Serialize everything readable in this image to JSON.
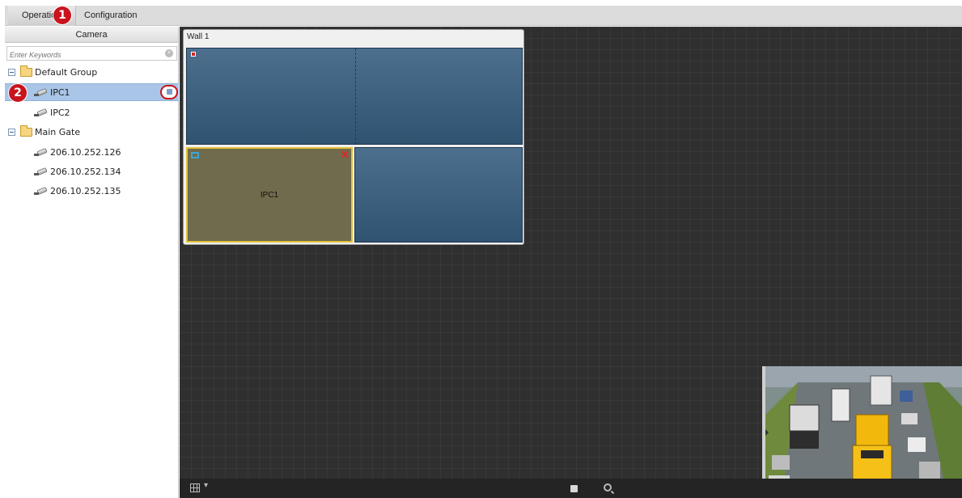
{
  "tabs": {
    "operation": "Operatio",
    "configuration": "Configuration"
  },
  "callouts": {
    "one": "1",
    "two": "2"
  },
  "sidebar": {
    "title": "Camera",
    "search_placeholder": "Enter Keywords",
    "groups": [
      {
        "label": "Default Group",
        "devices": [
          "IPC1",
          "IPC2"
        ]
      },
      {
        "label": "Main Gate",
        "devices": [
          "206.10.252.126",
          "206.10.252.134",
          "206.10.252.135"
        ]
      }
    ]
  },
  "wall": {
    "title": "Wall 1",
    "bound_screen_label": "IPC1"
  },
  "colors": {
    "accent": "#c8141e",
    "selected_row": "#a9c6e8",
    "screen_fill": "#3d6080",
    "bound_screen_fill": "#6f6b4c",
    "bound_screen_border": "#e3c23b"
  },
  "icons": [
    "clear-search-icon",
    "folder-icon",
    "camera-icon",
    "context-menu-icon",
    "alarm-flag-icon",
    "monitor-icon",
    "close-icon",
    "layout-grid-icon",
    "stop-icon",
    "zoom-icon"
  ]
}
